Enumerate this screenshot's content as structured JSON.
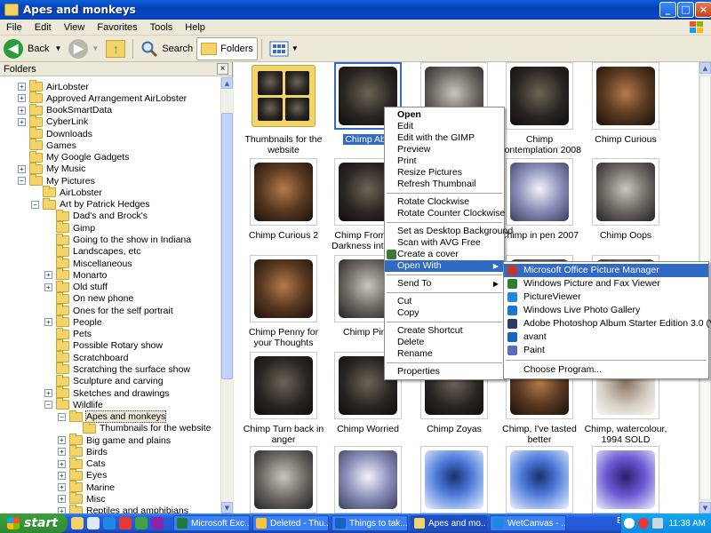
{
  "window": {
    "title": "Apes and monkeys",
    "buttons": [
      "_",
      "□",
      "×"
    ]
  },
  "menubar": [
    "File",
    "Edit",
    "View",
    "Favorites",
    "Tools",
    "Help"
  ],
  "toolbar": {
    "back": "Back",
    "search": "Search",
    "folders": "Folders"
  },
  "folders_pane": {
    "title": "Folders",
    "close": "×",
    "tree": [
      {
        "label": "AirLobster",
        "indent": 1,
        "expander": "+"
      },
      {
        "label": "Approved Arrangement AirLobster",
        "indent": 1,
        "expander": "+"
      },
      {
        "label": "BookSmartData",
        "indent": 1,
        "expander": "+"
      },
      {
        "label": "CyberLink",
        "indent": 1,
        "expander": "+"
      },
      {
        "label": "Downloads",
        "indent": 1,
        "expander": ""
      },
      {
        "label": "Games",
        "indent": 1,
        "expander": ""
      },
      {
        "label": "My Google Gadgets",
        "indent": 1,
        "expander": ""
      },
      {
        "label": "My Music",
        "indent": 1,
        "expander": "+"
      },
      {
        "label": "My Pictures",
        "indent": 1,
        "expander": "−"
      },
      {
        "label": "AirLobster",
        "indent": 2,
        "expander": ""
      },
      {
        "label": "Art by Patrick Hedges",
        "indent": 2,
        "expander": "−"
      },
      {
        "label": "Dad's and Brock's",
        "indent": 3,
        "expander": ""
      },
      {
        "label": "Gimp",
        "indent": 3,
        "expander": ""
      },
      {
        "label": "Going to the show in Indiana",
        "indent": 3,
        "expander": ""
      },
      {
        "label": "Landscapes, etc",
        "indent": 3,
        "expander": ""
      },
      {
        "label": "Miscellaneous",
        "indent": 3,
        "expander": ""
      },
      {
        "label": "Monarto",
        "indent": 3,
        "expander": "+"
      },
      {
        "label": "Old stuff",
        "indent": 3,
        "expander": "+"
      },
      {
        "label": "On new phone",
        "indent": 3,
        "expander": ""
      },
      {
        "label": "Ones for the self portrait",
        "indent": 3,
        "expander": ""
      },
      {
        "label": "People",
        "indent": 3,
        "expander": "+"
      },
      {
        "label": "Pets",
        "indent": 3,
        "expander": ""
      },
      {
        "label": "Possible Rotary show",
        "indent": 3,
        "expander": ""
      },
      {
        "label": "Scratchboard",
        "indent": 3,
        "expander": ""
      },
      {
        "label": "Scratching the surface show",
        "indent": 3,
        "expander": ""
      },
      {
        "label": "Sculpture and carving",
        "indent": 3,
        "expander": ""
      },
      {
        "label": "Sketches and drawings",
        "indent": 3,
        "expander": "+"
      },
      {
        "label": "Wildlife",
        "indent": 3,
        "expander": "−"
      },
      {
        "label": "Apes and monkeys",
        "indent": 4,
        "expander": "−",
        "selected": true
      },
      {
        "label": "Thumbnails for the website",
        "indent": 5,
        "expander": ""
      },
      {
        "label": "Big game and plains",
        "indent": 4,
        "expander": "+"
      },
      {
        "label": "Birds",
        "indent": 4,
        "expander": "+"
      },
      {
        "label": "Cats",
        "indent": 4,
        "expander": "+"
      },
      {
        "label": "Eyes",
        "indent": 4,
        "expander": "+"
      },
      {
        "label": "Marine",
        "indent": 4,
        "expander": "+"
      },
      {
        "label": "Misc",
        "indent": 4,
        "expander": "+"
      },
      {
        "label": "Reptiles and amphibians",
        "indent": 4,
        "expander": "+"
      }
    ]
  },
  "files": [
    {
      "caption": "Thumbnails for the website",
      "kind": "folder"
    },
    {
      "caption": "Chimp Abu",
      "kind": "dark",
      "selected": true
    },
    {
      "caption": "",
      "kind": "gray"
    },
    {
      "caption": "Chimp Contemplation 2008",
      "kind": "dark"
    },
    {
      "caption": "Chimp Curious",
      "kind": "warm"
    },
    {
      "caption": "Chimp Curious 2",
      "kind": "warm"
    },
    {
      "caption": "Chimp From the Darkness into the",
      "kind": "dark"
    },
    {
      "caption": "",
      "kind": "dark"
    },
    {
      "caption": "Chimp in pen 2007",
      "kind": "pen"
    },
    {
      "caption": "Chimp Oops",
      "kind": "gray"
    },
    {
      "caption": "Chimp Penny for your Thoughts",
      "kind": "warm"
    },
    {
      "caption": "Chimp Pinki",
      "kind": "gray"
    },
    {
      "caption": "",
      "kind": "dark"
    },
    {
      "caption": "",
      "kind": "gray"
    },
    {
      "caption": "",
      "kind": "gray"
    },
    {
      "caption": "Chimp Turn back in anger",
      "kind": "dark"
    },
    {
      "caption": "Chimp Worried",
      "kind": "dark"
    },
    {
      "caption": "Chimp Zoyas",
      "kind": "dark"
    },
    {
      "caption": "Chimp, I've tasted better",
      "kind": "warm"
    },
    {
      "caption": "Chimp, watercolour, 1994 SOLD",
      "kind": "light"
    },
    {
      "caption": "",
      "kind": "gray"
    },
    {
      "caption": "",
      "kind": "pen"
    },
    {
      "caption": "",
      "kind": "blue"
    },
    {
      "caption": "",
      "kind": "blue"
    },
    {
      "caption": "",
      "kind": "purple"
    }
  ],
  "context_menu": [
    {
      "label": "Open",
      "bold": true
    },
    {
      "label": "Edit"
    },
    {
      "label": "Edit with the GIMP"
    },
    {
      "label": "Preview"
    },
    {
      "label": "Print"
    },
    {
      "label": "Resize Pictures"
    },
    {
      "label": "Refresh Thumbnail"
    },
    {
      "sep": true
    },
    {
      "label": "Rotate Clockwise"
    },
    {
      "label": "Rotate Counter Clockwise"
    },
    {
      "sep": true
    },
    {
      "label": "Set as Desktop Background"
    },
    {
      "label": "Scan with AVG Free"
    },
    {
      "label": "Create a cover",
      "icon": "cover-icon"
    },
    {
      "label": "Open With",
      "arrow": "▶",
      "highlight": true
    },
    {
      "sep": true
    },
    {
      "label": "Send To",
      "arrow": "▶"
    },
    {
      "sep": true
    },
    {
      "label": "Cut"
    },
    {
      "label": "Copy"
    },
    {
      "sep": true
    },
    {
      "label": "Create Shortcut"
    },
    {
      "label": "Delete"
    },
    {
      "label": "Rename"
    },
    {
      "sep": true
    },
    {
      "label": "Properties"
    }
  ],
  "open_with_menu": [
    {
      "label": "Microsoft Office Picture Manager",
      "icon": "picture-manager-icon",
      "color": "#c0392b",
      "highlight": true
    },
    {
      "label": "Windows Picture and Fax Viewer",
      "icon": "fax-viewer-icon",
      "color": "#2e7d32"
    },
    {
      "label": "PictureViewer",
      "icon": "picture-viewer-icon",
      "color": "#1e88e5"
    },
    {
      "label": "Windows Live Photo Gallery",
      "icon": "photo-gallery-icon",
      "color": "#1976d2"
    },
    {
      "label": "Adobe Photoshop Album Starter Edition 3.0 (Viewer)",
      "icon": "photoshop-album-icon",
      "color": "#2b3a67"
    },
    {
      "label": "avant",
      "icon": "avant-icon",
      "color": "#1565c0"
    },
    {
      "label": "Paint",
      "icon": "paint-icon",
      "color": "#5c6bc0"
    },
    {
      "sep": true
    },
    {
      "label": "Choose Program..."
    }
  ],
  "taskbar": {
    "start": "start",
    "tasks": [
      {
        "label": "Microsoft Exc...",
        "color": "#1f7a3a"
      },
      {
        "label": "Deleted - Thu...",
        "color": "#f5c542"
      },
      {
        "label": "Things to tak...",
        "color": "#1565c0"
      },
      {
        "label": "Apes and mo...",
        "color": "#f3d46b",
        "active": true
      },
      {
        "label": "WetCanvas - ...",
        "color": "#1e88e5"
      }
    ],
    "lang": "EN",
    "clock": "11:38 AM"
  }
}
